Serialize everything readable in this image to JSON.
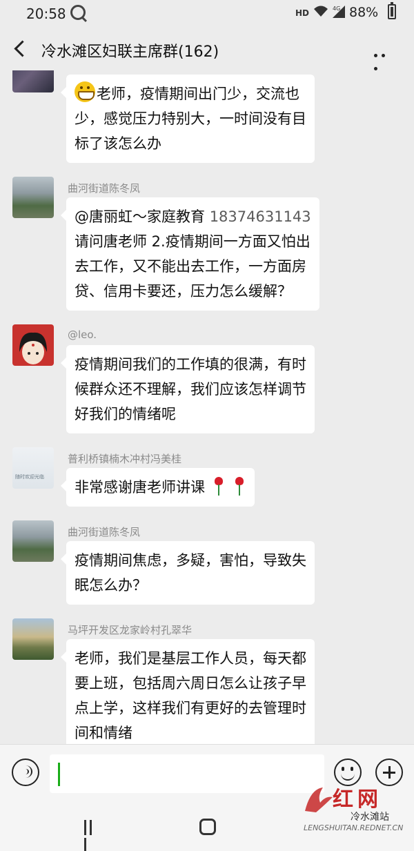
{
  "status_bar": {
    "time": "20:58",
    "hd": "HD",
    "network": "4G",
    "battery": "88%"
  },
  "header": {
    "title": "冷水滩区妇联主席群(162)"
  },
  "messages": [
    {
      "sender": "",
      "avatar_icon": "avatar-icon",
      "lines": [
        "老师，疫情期间出门少，交流也",
        "少，感觉压力特别大，一时间没有目",
        "标了该怎么办"
      ]
    },
    {
      "sender": "曲河街道陈冬凤",
      "avatar_icon": "avatar-icon",
      "mention": "@唐丽虹～家庭教育",
      "phone": "18374631143",
      "lines": [
        "请问唐老师 2.疫情期间一方面又怕出",
        "去工作，又不能出去工作，一方面房",
        "贷、信用卡要还，压力怎么缓解？"
      ]
    },
    {
      "sender": "@leo.",
      "avatar_icon": "avatar-icon",
      "lines": [
        "疫情期间我们的工作填的很满，有时",
        "候群众还不理解，我们应该怎样调节",
        "好我们的情绪呢"
      ]
    },
    {
      "sender": "普利桥镇楠木冲村冯美桂",
      "avatar_icon": "avatar-icon",
      "avatar_caption": "随时欢迎光临",
      "lines": [
        "非常感谢唐老师讲课"
      ]
    },
    {
      "sender": "曲河街道陈冬凤",
      "avatar_icon": "avatar-icon",
      "lines": [
        "疫情期间焦虑，多疑，害怕，导致失",
        "眠怎么办？"
      ]
    },
    {
      "sender": "马坪开发区龙家岭村孔翠华",
      "avatar_icon": "avatar-icon",
      "lines": [
        "老师，我们是基层工作人员，每天都",
        "要上班，包括周六周日怎么让孩子早",
        "点上学，这样我们有更好的去管理时",
        "间和情绪"
      ]
    }
  ],
  "input": {
    "value": ""
  },
  "watermark": {
    "brand": "红网",
    "station": "冷水滩站",
    "url": "LENGSHUITAN.REDNET.CN"
  },
  "colors": {
    "background": "#ececec",
    "bubble": "#ffffff",
    "sender_text": "#8a8a8a",
    "caret": "#1aad19",
    "watermark_red": "#c62828"
  }
}
